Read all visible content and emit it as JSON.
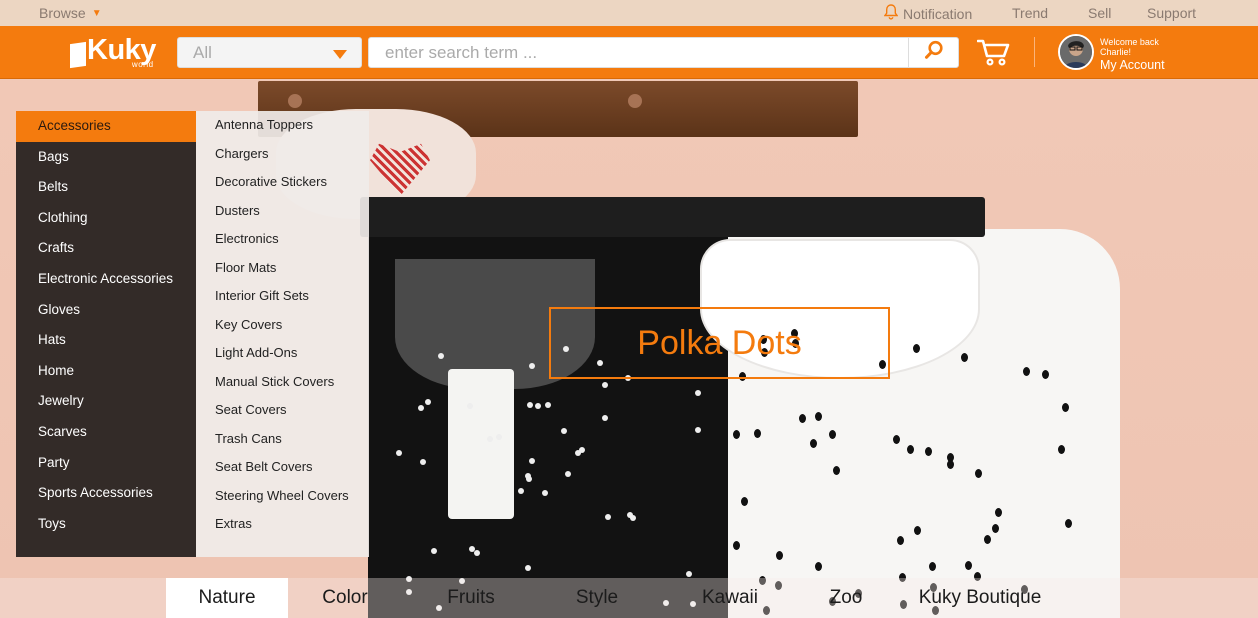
{
  "topbar": {
    "browse_label": "Browse",
    "notification_label": "Notification",
    "trend_label": "Trend",
    "sell_label": "Sell",
    "support_label": "Support"
  },
  "header": {
    "logo_text": "Kuky",
    "logo_sub": "world",
    "category_value": "All",
    "search_placeholder": "enter search term ...",
    "welcome_text": "Welcome back",
    "user_name": "Charlie!",
    "account_label": "My Account"
  },
  "hero": {
    "badge_text": "Polka Dots"
  },
  "menu": {
    "items": [
      "Accessories",
      "Bags",
      "Belts",
      "Clothing",
      "Crafts",
      "Electronic Accessories",
      "Gloves",
      "Hats",
      "Home",
      "Jewelry",
      "Scarves",
      "Party",
      "Sports Accessories",
      "Toys"
    ],
    "active_index": 0
  },
  "submenu": {
    "items": [
      "Antenna Toppers",
      "Chargers",
      "Decorative Stickers",
      "Dusters",
      "Electronics",
      "Floor Mats",
      "Interior Gift Sets",
      "Key Covers",
      "Light Add-Ons",
      "Manual Stick Covers",
      "Seat Covers",
      "Trash Cans",
      "Seat Belt Covers",
      "Steering Wheel Covers",
      "Extras"
    ]
  },
  "tabs": {
    "items": [
      "Nature",
      "Color",
      "Fruits",
      "Style",
      "Kawaii",
      "Zoo",
      "Kuky Boutique"
    ],
    "active_index": 0
  },
  "colors": {
    "accent": "#f47b0e",
    "menu_bg": "#332b28",
    "topbar_bg": "#ecd6c2"
  },
  "icons": {
    "notification": "bell-icon",
    "search": "magnifier-icon",
    "cart": "cart-icon",
    "dropdown": "caret-down-icon"
  }
}
